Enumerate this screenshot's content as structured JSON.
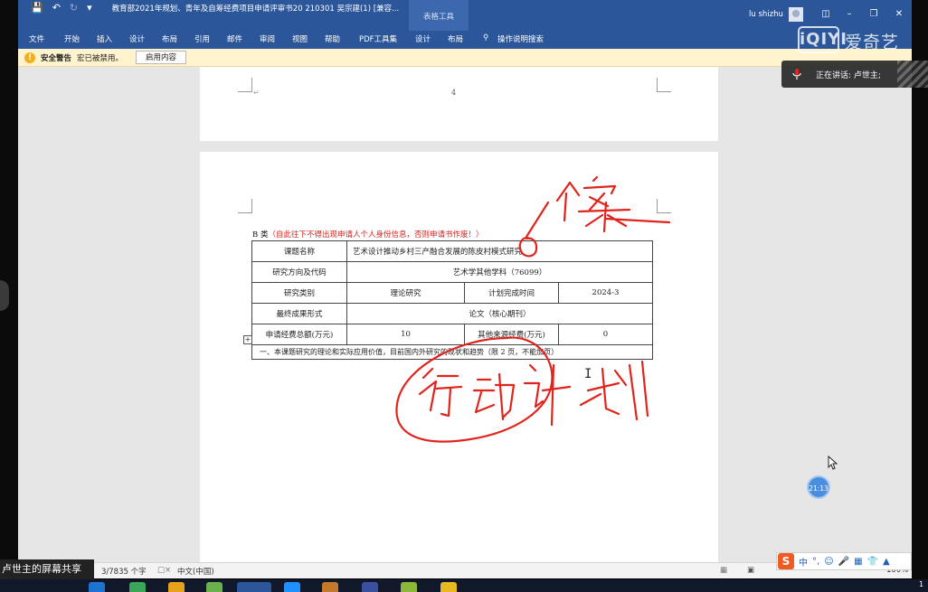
{
  "window": {
    "title": "教育部2021年规划、青年及自筹经费项目申请评审书20 210301 吴宗建(1) [兼容...",
    "context_tab": "表格工具",
    "user": "lu shizhu",
    "quick_access": [
      "save",
      "undo",
      "redo",
      "customize"
    ]
  },
  "ribbon": {
    "tabs": [
      "文件",
      "开始",
      "插入",
      "设计",
      "布局",
      "引用",
      "邮件",
      "审阅",
      "视图",
      "帮助",
      "PDF工具集",
      "设计",
      "布局"
    ],
    "tell_me": "操作说明搜索"
  },
  "message_bar": {
    "title": "安全警告",
    "text": "宏已被禁用。",
    "button": "启用内容"
  },
  "page4": {
    "page_number": "4"
  },
  "form": {
    "section_prefix": "B 类",
    "section_note": "（自此往下不得出现申请人个人身份信息，否则申请书作废！）",
    "rows": {
      "topic_label": "课题名称",
      "topic_value": "艺术设计推动乡村三产融合发展的陈皮村模式研究",
      "direction_label": "研究方向及代码",
      "direction_value": "艺术学其他学科（76099）",
      "category_label": "研究类别",
      "category_value": "理论研究",
      "plan_label": "计划完成时间",
      "plan_value": "2024-3",
      "result_label": "最终成果形式",
      "result_value": "论文（核心期刊）",
      "funding_label": "申请经费总额(万元)",
      "funding_value": "10",
      "other_label": "其他来源经费(万元)",
      "other_value": "0",
      "section_one": "一、本课题研究的理论和实际应用价值，目前国内外研究的现状和趋势（限 2 页，不能加页）"
    }
  },
  "status_bar": {
    "words": "3/7835 个字",
    "language": "中文(中国)",
    "zoom": "100%"
  },
  "overlays": {
    "iqiyi_box": "iQIYI",
    "iqiyi_text": "爱奇艺",
    "speaking": "正在讲话: 卢世主;",
    "timer": "21:13",
    "screen_share": "卢世主的屏幕共享",
    "ime": [
      "中",
      "°,",
      "☺",
      "🎤",
      "▦",
      "👕",
      "▲",
      "▦"
    ]
  },
  "colors": {
    "titlebar": "#2b579a",
    "warning_bg": "#fff4ce",
    "annotation_red": "#e0241c",
    "note_red": "#d9201b"
  }
}
